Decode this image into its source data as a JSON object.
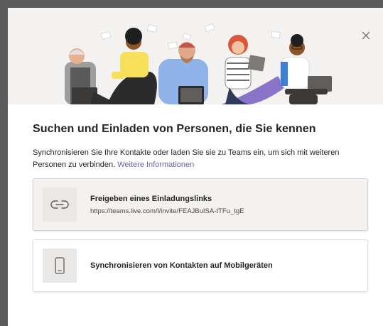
{
  "dialog": {
    "title": "Suchen und Einladen von Personen, die Sie kennen",
    "description": "Synchronisieren Sie Ihre Kontakte oder laden Sie sie zu Teams ein, um sich mit weiteren Personen zu verbinden.",
    "learn_more": "Weitere Informationen",
    "close_icon": "close-icon"
  },
  "options": [
    {
      "title": "Freigeben eines Einladungslinks",
      "subtitle": "https://teams.live.com/l/invite/FEAJBuISA-tTFu_tgE",
      "icon": "link-icon"
    },
    {
      "title": "Synchronisieren von Kontakten auf Mobilgeräten",
      "icon": "mobile-phone-icon"
    }
  ],
  "colors": {
    "accent": "#6264a7",
    "hero_background": "#f3f2f1",
    "backdrop": "#5b5b5b"
  }
}
